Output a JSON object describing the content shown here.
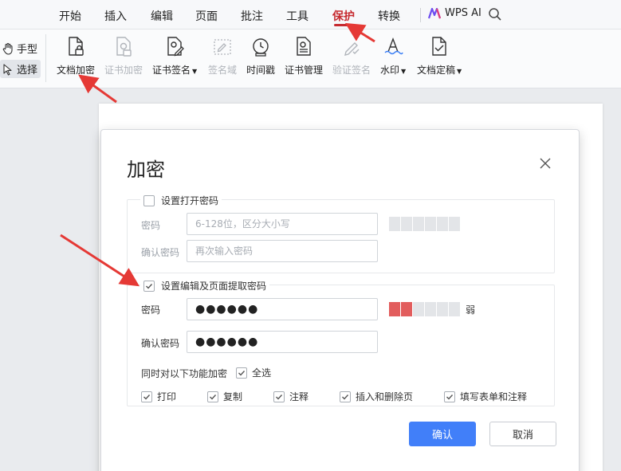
{
  "menubar": {
    "items": [
      "开始",
      "插入",
      "编辑",
      "页面",
      "批注",
      "工具",
      "保护",
      "转换"
    ],
    "active_index": 6,
    "wps_ai_label": "WPS AI"
  },
  "ribbon": {
    "mode_hand": "手型",
    "mode_select": "选择",
    "buttons": [
      {
        "label": "文档加密",
        "enabled": true
      },
      {
        "label": "证书加密",
        "enabled": false
      },
      {
        "label": "证书签名",
        "enabled": true,
        "dropdown": true
      },
      {
        "label": "签名域",
        "enabled": false
      },
      {
        "label": "时间戳",
        "enabled": true
      },
      {
        "label": "证书管理",
        "enabled": true
      },
      {
        "label": "验证签名",
        "enabled": false
      },
      {
        "label": "水印",
        "enabled": true,
        "dropdown": true
      },
      {
        "label": "文档定稿",
        "enabled": true,
        "dropdown": true
      }
    ]
  },
  "dialog": {
    "title": "加密",
    "open_password": {
      "checkbox_label": "设置打开密码",
      "checked": false,
      "password_label": "密码",
      "password_placeholder": "6-128位，区分大小写",
      "confirm_label": "确认密码",
      "confirm_placeholder": "再次输入密码"
    },
    "edit_password": {
      "checkbox_label": "设置编辑及页面提取密码",
      "checked": true,
      "password_label": "密码",
      "password_value": "●●●●●●",
      "strength_label": "弱",
      "strength_level": 2,
      "strength_segments": 6,
      "confirm_label": "确认密码",
      "confirm_value": "●●●●●●",
      "apply_label": "同时对以下功能加密",
      "select_all_label": "全选",
      "options": [
        "打印",
        "复制",
        "注释",
        "插入和删除页",
        "填写表单和注释"
      ]
    },
    "ok_label": "确认",
    "cancel_label": "取消"
  },
  "colors": {
    "accent_red": "#c62a2f",
    "primary_blue": "#417ff9",
    "strength_weak": "#e25d5d",
    "annotation_arrow": "#e53935"
  }
}
